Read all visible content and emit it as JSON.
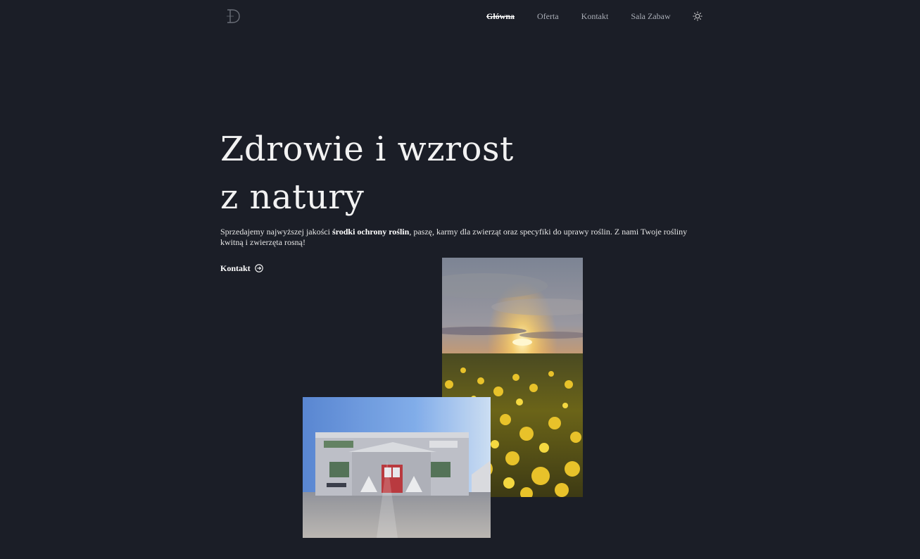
{
  "header": {
    "logo_icon": "monogram-d-logo",
    "nav": [
      {
        "label": "Główna",
        "active": true
      },
      {
        "label": "Oferta",
        "active": false
      },
      {
        "label": "Kontakt",
        "active": false
      },
      {
        "label": "Sala Zabaw",
        "active": false
      }
    ],
    "theme_icon": "sun-icon"
  },
  "hero": {
    "title_line1": "Zdrowie i wzrost",
    "title_line2": "z natury",
    "desc_before": "Sprzedajemy najwyższej jakości ",
    "desc_bold": "środki ochrony roślin",
    "desc_after": ", paszę, karmy dla zwierząt oraz specyfiki do uprawy roślin. Z nami Twoje rośliny kwitną i zwierzęta rosną!",
    "cta_label": "Kontakt",
    "cta_icon": "arrow-circle-right-icon"
  },
  "images": {
    "field": "sunset-rapeseed-field-photo",
    "shop": "store-building-photo"
  },
  "colors": {
    "background": "#1b1e27",
    "nav_inactive": "#a9adb6",
    "text": "#f2f2f2"
  }
}
